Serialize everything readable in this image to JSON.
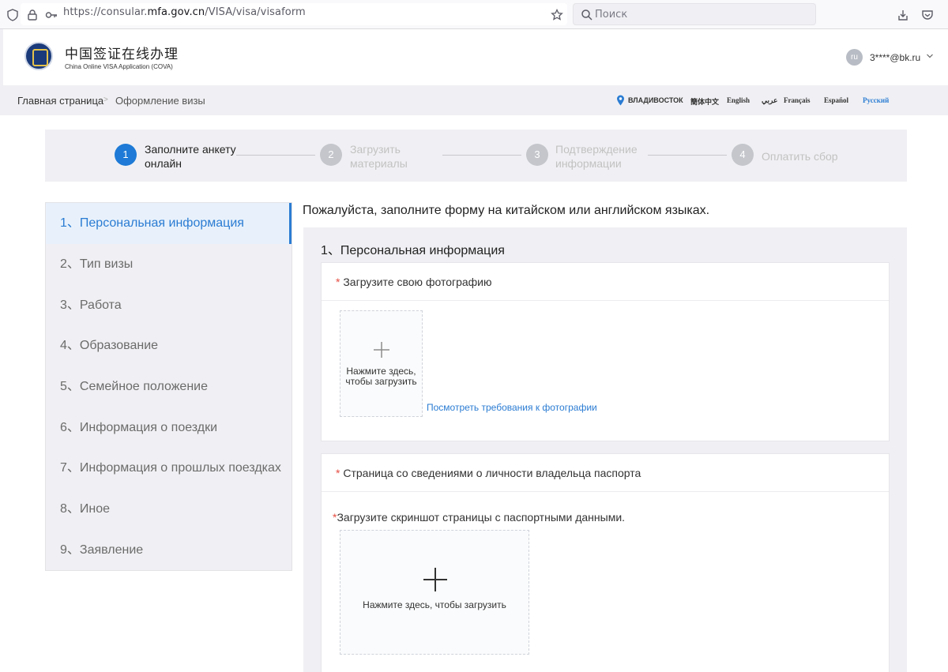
{
  "browser": {
    "url_prefix": "https://consular.",
    "url_domain": "mfa.gov.cn",
    "url_path": "/VISA/visa/visaform",
    "search_placeholder": "Поиск"
  },
  "header": {
    "title": "中国签证在线办理",
    "subtitle": "China Online VISA Application  (COVA)",
    "avatar_text": "ru",
    "user_email": "3****@bk.ru"
  },
  "breadcrumb": {
    "home": "Главная страница",
    "separator": ">",
    "current": "Оформление визы",
    "location": "ВЛАДИВОСТОК"
  },
  "languages": [
    {
      "label": "簡体中文",
      "active": false
    },
    {
      "label": "English",
      "active": false
    },
    {
      "label": "عربي",
      "active": false
    },
    {
      "label": "Français",
      "active": false
    },
    {
      "label": "Español",
      "active": false
    },
    {
      "label": "Русский",
      "active": true
    }
  ],
  "steps": [
    {
      "num": "1",
      "label": "Заполните анкету онлайн",
      "active": true
    },
    {
      "num": "2",
      "label": "Загрузить материалы",
      "active": false
    },
    {
      "num": "3",
      "label": "Подтверждение информации",
      "active": false
    },
    {
      "num": "4",
      "label": "Оплатить сбор",
      "active": false
    }
  ],
  "nav": [
    {
      "label": "1、Персональная информация",
      "active": true
    },
    {
      "label": "2、Тип визы",
      "active": false
    },
    {
      "label": "3、Работа",
      "active": false
    },
    {
      "label": "4、Образование",
      "active": false
    },
    {
      "label": "5、Семейное положение",
      "active": false
    },
    {
      "label": "6、Информация о поездки",
      "active": false
    },
    {
      "label": "7、Информация о прошлых поездках",
      "active": false
    },
    {
      "label": "8、Иное",
      "active": false
    },
    {
      "label": "9、Заявление",
      "active": false
    }
  ],
  "form": {
    "hint": "Пожалуйста, заполните форму на китайском или английском языках.",
    "section_title": "1、Персональная информация",
    "required_mark": "*",
    "photo_card": {
      "title": "Загрузите свою фотографию",
      "upload_text": "Нажмите здесь, чтобы загрузить",
      "requirements_link": "Посмотреть требования к фотографии"
    },
    "passport_card": {
      "title": "Страница со сведениями о личности владельца паспорта",
      "upload_label": "Загрузите скриншот страницы с паспортными данными.",
      "upload_text": "Нажмите здесь, чтобы загрузить"
    }
  },
  "colors": {
    "accent": "#2b7cd3",
    "step_active": "#1e7ad6",
    "required": "#e54d42"
  }
}
